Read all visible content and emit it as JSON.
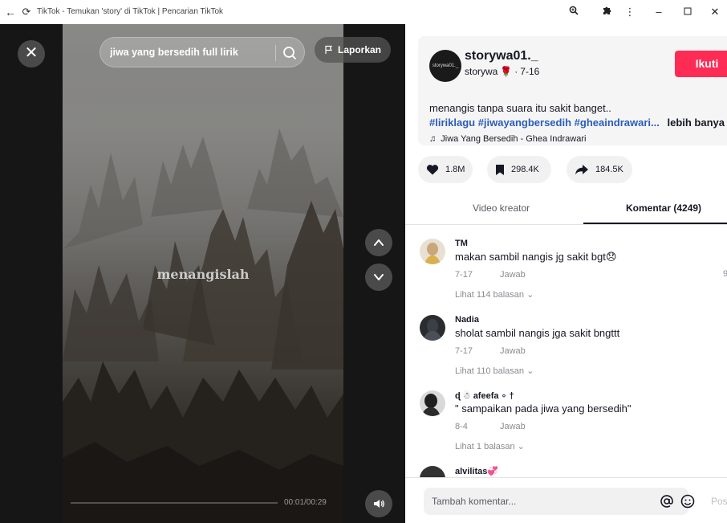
{
  "window": {
    "title": "TikTok - Temukan 'story' di TikTok | Pencarian TikTok"
  },
  "video": {
    "search_value": "jiwa yang bersedih full lirik",
    "report_label": "Laporkan",
    "overlay_text": "menangislah",
    "time": "00:01/00:29",
    "progress": 0.03
  },
  "author": {
    "username": "storywa01._",
    "nickname": "storywa",
    "date": "7-16",
    "avatar_text": "storywa01._",
    "follow_label": "Ikuti",
    "caption": "menangis tanpa suara itu sakit banget..",
    "hashtags": [
      "#liriklagu",
      "#jiwayangbersedih",
      "#gheaindrawari..."
    ],
    "more_label": "lebih banya",
    "music": "Jiwa Yang Bersedih - Ghea Indrawari"
  },
  "actions": {
    "likes": "1.8M",
    "saves": "298.4K",
    "shares": "184.5K"
  },
  "tabs": {
    "creator": "Video kreator",
    "comments": "Komentar (4249)"
  },
  "comments": [
    {
      "name": "TM",
      "text": "makan sambil nangis jg sakit bgt😞",
      "date": "7-17",
      "reply": "Jawab",
      "more": "Lihat 114 balasan",
      "like_count": "9"
    },
    {
      "name": "Nadia",
      "text": "sholat sambil nangis jga sakit bngttt",
      "date": "7-17",
      "reply": "Jawab",
      "more": "Lihat 110 balasan"
    },
    {
      "name": "ɖ ☃ afeefa ∘ †",
      "text": "\" sampaikan pada jiwa yang bersedih\"",
      "date": "8-4",
      "reply": "Jawab",
      "more": "Lihat 1 balasan"
    },
    {
      "name": "alvilitas💞"
    }
  ],
  "footer": {
    "placeholder": "Tambah komentar...",
    "post_label": "Pos"
  },
  "colors": {
    "accent": "#fe2c55",
    "hashtag": "#2b5db9"
  }
}
